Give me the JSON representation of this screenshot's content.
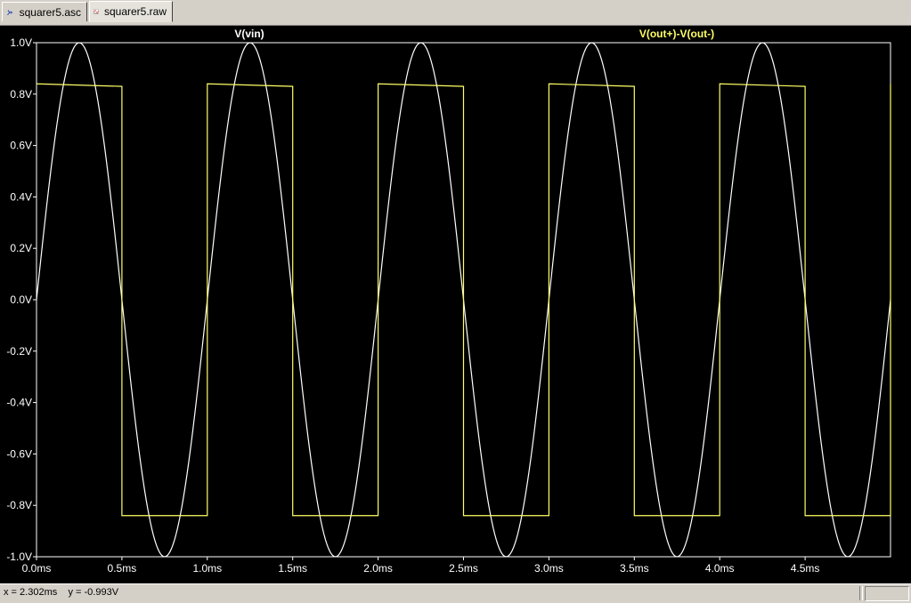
{
  "tabs": [
    {
      "label": "squarer5.asc",
      "icon": "schematic-icon",
      "active": false
    },
    {
      "label": "squarer5.raw",
      "icon": "waveform-icon",
      "active": true
    }
  ],
  "colors": {
    "background": "#000000",
    "frame": "#ffffff",
    "trace_vin": "#ffffff",
    "trace_out": "#ffff66",
    "axis_text": "#ffffff"
  },
  "chart_data": {
    "type": "line",
    "xlim": [
      0,
      5
    ],
    "ylim": [
      -1.0,
      1.0
    ],
    "x_ticks": [
      {
        "value": 0.0,
        "label": "0.0ms"
      },
      {
        "value": 0.5,
        "label": "0.5ms"
      },
      {
        "value": 1.0,
        "label": "1.0ms"
      },
      {
        "value": 1.5,
        "label": "1.5ms"
      },
      {
        "value": 2.0,
        "label": "2.0ms"
      },
      {
        "value": 2.5,
        "label": "2.5ms"
      },
      {
        "value": 3.0,
        "label": "3.0ms"
      },
      {
        "value": 3.5,
        "label": "3.5ms"
      },
      {
        "value": 4.0,
        "label": "4.0ms"
      },
      {
        "value": 4.5,
        "label": "4.5ms"
      }
    ],
    "y_ticks": [
      {
        "value": 1.0,
        "label": "1.0V"
      },
      {
        "value": 0.8,
        "label": "0.8V"
      },
      {
        "value": 0.6,
        "label": "0.6V"
      },
      {
        "value": 0.4,
        "label": "0.4V"
      },
      {
        "value": 0.2,
        "label": "0.2V"
      },
      {
        "value": 0.0,
        "label": "0.0V"
      },
      {
        "value": -0.2,
        "label": "-0.2V"
      },
      {
        "value": -0.4,
        "label": "-0.4V"
      },
      {
        "value": -0.6,
        "label": "-0.6V"
      },
      {
        "value": -0.8,
        "label": "-0.8V"
      },
      {
        "value": -1.0,
        "label": "-1.0V"
      }
    ],
    "series": [
      {
        "name": "V(vin)",
        "color": "#ffffff",
        "x": [
          0,
          0.125,
          0.25,
          0.375,
          0.5,
          0.625,
          0.75,
          0.875,
          1.0,
          1.125,
          1.25,
          1.375,
          1.5,
          1.625,
          1.75,
          1.875,
          2.0,
          2.125,
          2.25,
          2.375,
          2.5,
          2.625,
          2.75,
          2.875,
          3.0,
          3.125,
          3.25,
          3.375,
          3.5,
          3.625,
          3.75,
          3.875,
          4.0,
          4.125,
          4.25,
          4.375,
          4.5,
          4.625,
          4.75,
          4.875,
          5.0
        ],
        "y": [
          0,
          0.707,
          1.0,
          0.707,
          0,
          -0.707,
          -1.0,
          -0.707,
          0,
          0.707,
          1.0,
          0.707,
          0,
          -0.707,
          -1.0,
          -0.707,
          0,
          0.707,
          1.0,
          0.707,
          0,
          -0.707,
          -1.0,
          -0.707,
          0,
          0.707,
          1.0,
          0.707,
          0,
          -0.707,
          -1.0,
          -0.707,
          0,
          0.707,
          1.0,
          0.707,
          0,
          -0.707,
          -1.0,
          -0.707,
          0
        ]
      },
      {
        "name": "V(out+)-V(out-)",
        "color": "#ffff66",
        "x": [
          0,
          0.5,
          0.5,
          1.0,
          1.0,
          1.5,
          1.5,
          2.0,
          2.0,
          2.5,
          2.5,
          3.0,
          3.0,
          3.5,
          3.5,
          4.0,
          4.0,
          4.5,
          4.5,
          5.0,
          5.0
        ],
        "y": [
          0.84,
          0.83,
          -0.84,
          -0.84,
          0.84,
          0.83,
          -0.84,
          -0.84,
          0.84,
          0.83,
          -0.84,
          -0.84,
          0.84,
          0.83,
          -0.84,
          -0.84,
          0.84,
          0.83,
          -0.84,
          -0.84,
          0.84
        ]
      }
    ]
  },
  "status": {
    "x_readout": "x = 2.302ms",
    "y_readout": "y = -0.993V"
  }
}
